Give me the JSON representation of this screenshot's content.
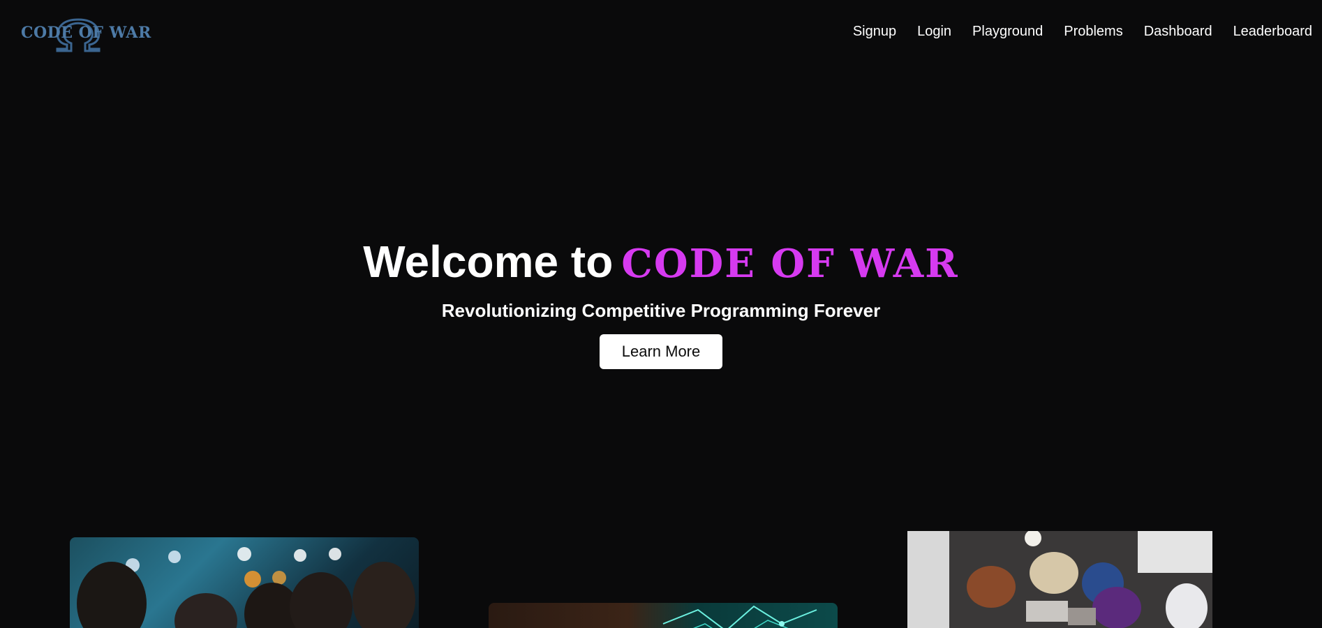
{
  "header": {
    "logo": {
      "text": "CODE OF WAR",
      "color": "#4d7aa6",
      "icon": "omega-logo-icon"
    },
    "nav": [
      {
        "label": "Signup"
      },
      {
        "label": "Login"
      },
      {
        "label": "Playground"
      },
      {
        "label": "Problems"
      },
      {
        "label": "Dashboard"
      },
      {
        "label": "Leaderboard"
      }
    ]
  },
  "hero": {
    "title_prefix": "Welcome to",
    "title_brand": "CODE OF WAR",
    "brand_color": "#d63af0",
    "subtitle": "Revolutionizing Competitive Programming Forever",
    "cta_label": "Learn More"
  },
  "cards": [
    {
      "image": "students-coding-photo"
    },
    {
      "image": "neon-circuit-photo"
    },
    {
      "image": "hackathon-overhead-photo"
    }
  ],
  "colors": {
    "background": "#0a0a0b",
    "text": "#ffffff",
    "button_bg": "#ffffff"
  }
}
